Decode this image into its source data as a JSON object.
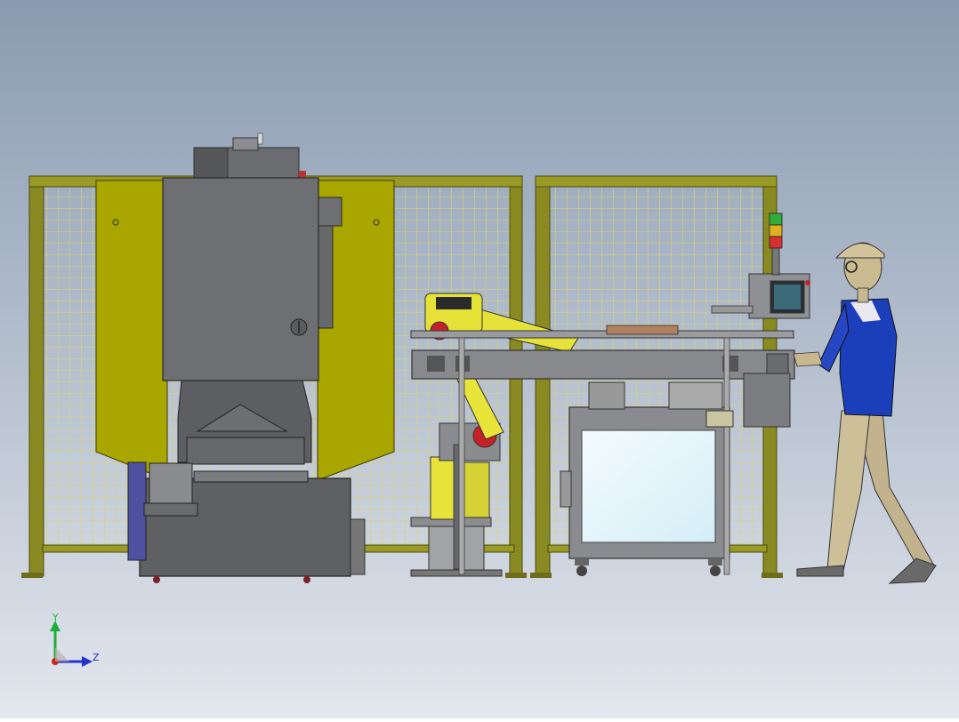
{
  "viewport": {
    "background_top": "#8d9db2",
    "background_bottom": "#dfe4ec"
  },
  "colors": {
    "fence_frame": "#8a8a2a",
    "mesh": "#d8d66a",
    "panel_yellow": "#aaa800",
    "machine_gray": "#6f7073",
    "machine_dark": "#55565a",
    "robot_yellow": "#e8e43a",
    "robot_red": "#c8202a",
    "shirt_blue": "#1b3fb8",
    "skin": "#c9b78f",
    "screen": "#e9f7fb"
  },
  "triad": {
    "y_label": "Y",
    "z_label": "Z",
    "y_color": "#1fae3a",
    "z_color": "#2233cc",
    "origin_color": "#cc2222"
  },
  "components": [
    "safety-fence-left",
    "safety-fence-right",
    "cnc-machine-tool",
    "industrial-robot-arm",
    "belt-conveyor",
    "operator-control-panel",
    "signal-tower-light",
    "operator-figure"
  ]
}
